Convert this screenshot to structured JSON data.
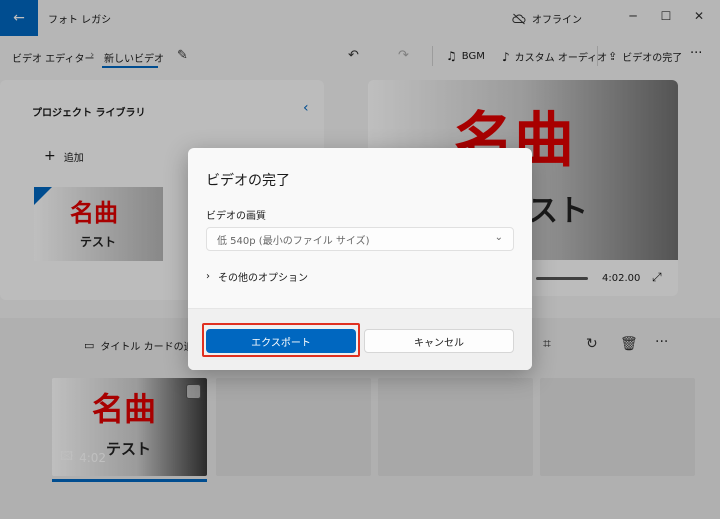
{
  "titlebar": {
    "app_title": "フォト レガシ",
    "status": "オフライン",
    "back_icon": "arrow-left-icon",
    "minimize": "─",
    "maximize": "☐",
    "close": "✕"
  },
  "toolbar": {
    "breadcrumb_root": "ビデオ エディター",
    "breadcrumb_sep": "›",
    "project_name": "新しいビデオ",
    "bgm_label": "BGM",
    "custom_audio_label": "カスタム オーディオ",
    "finish_label": "ビデオの完了",
    "more": "···"
  },
  "library": {
    "title": "プロジェクト ライブラリ",
    "add_label": "追加",
    "thumb_title": "名曲",
    "thumb_subtitle": "テスト"
  },
  "preview": {
    "title": "名曲",
    "subtitle": "テスト",
    "time": "4:02.00"
  },
  "storyboard": {
    "add_title_card": "タイトル カードの追加",
    "clip": {
      "title": "名曲",
      "subtitle": "テスト",
      "duration": "4:02"
    },
    "more": "···"
  },
  "dialog": {
    "title": "ビデオの完了",
    "quality_label": "ビデオの画質",
    "quality_value": "低 540p (最小のファイル サイズ)",
    "more_options": "その他のオプション",
    "export_button": "エクスポート",
    "cancel_button": "キャンセル"
  },
  "colors": {
    "accent": "#0067c0",
    "title_red": "#e00000",
    "highlight_red": "#e03020"
  }
}
